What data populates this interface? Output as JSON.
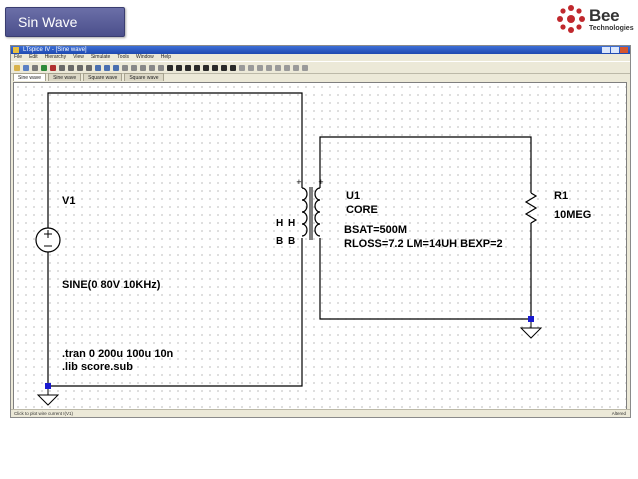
{
  "slide": {
    "title": "Sin Wave",
    "logo": {
      "word": "Bee",
      "sub": "Technologies"
    }
  },
  "window": {
    "title": "LTspice IV - [Sine wave]",
    "menu": [
      "File",
      "Edit",
      "Hierarchy",
      "View",
      "Simulate",
      "Tools",
      "Window",
      "Help"
    ],
    "tabs": [
      "Sine wave",
      "Sine wave",
      "Square wave",
      "Square wave"
    ],
    "active_tab": 0,
    "status_left": "Click to plot wire current I(V1)",
    "status_right": "Altered"
  },
  "schematic": {
    "source_name": "V1",
    "source_value": "SINE(0 80V 10KHz)",
    "directives": [
      ".tran 0 200u 100u 10n",
      ".lib score.sub"
    ],
    "transformer_name": "U1",
    "transformer_model": "CORE",
    "pin_labels": [
      "H",
      "H",
      "B",
      "B"
    ],
    "params": [
      "BSAT=500M",
      "RLOSS=7.2 LM=14UH BEXP=2"
    ],
    "resistor_name": "R1",
    "resistor_value": "10MEG"
  },
  "colors": {
    "badge": "#5a5e9c",
    "titlebar": "#2a5bc4",
    "wire": "#000000",
    "node": "#1a1ad0"
  }
}
